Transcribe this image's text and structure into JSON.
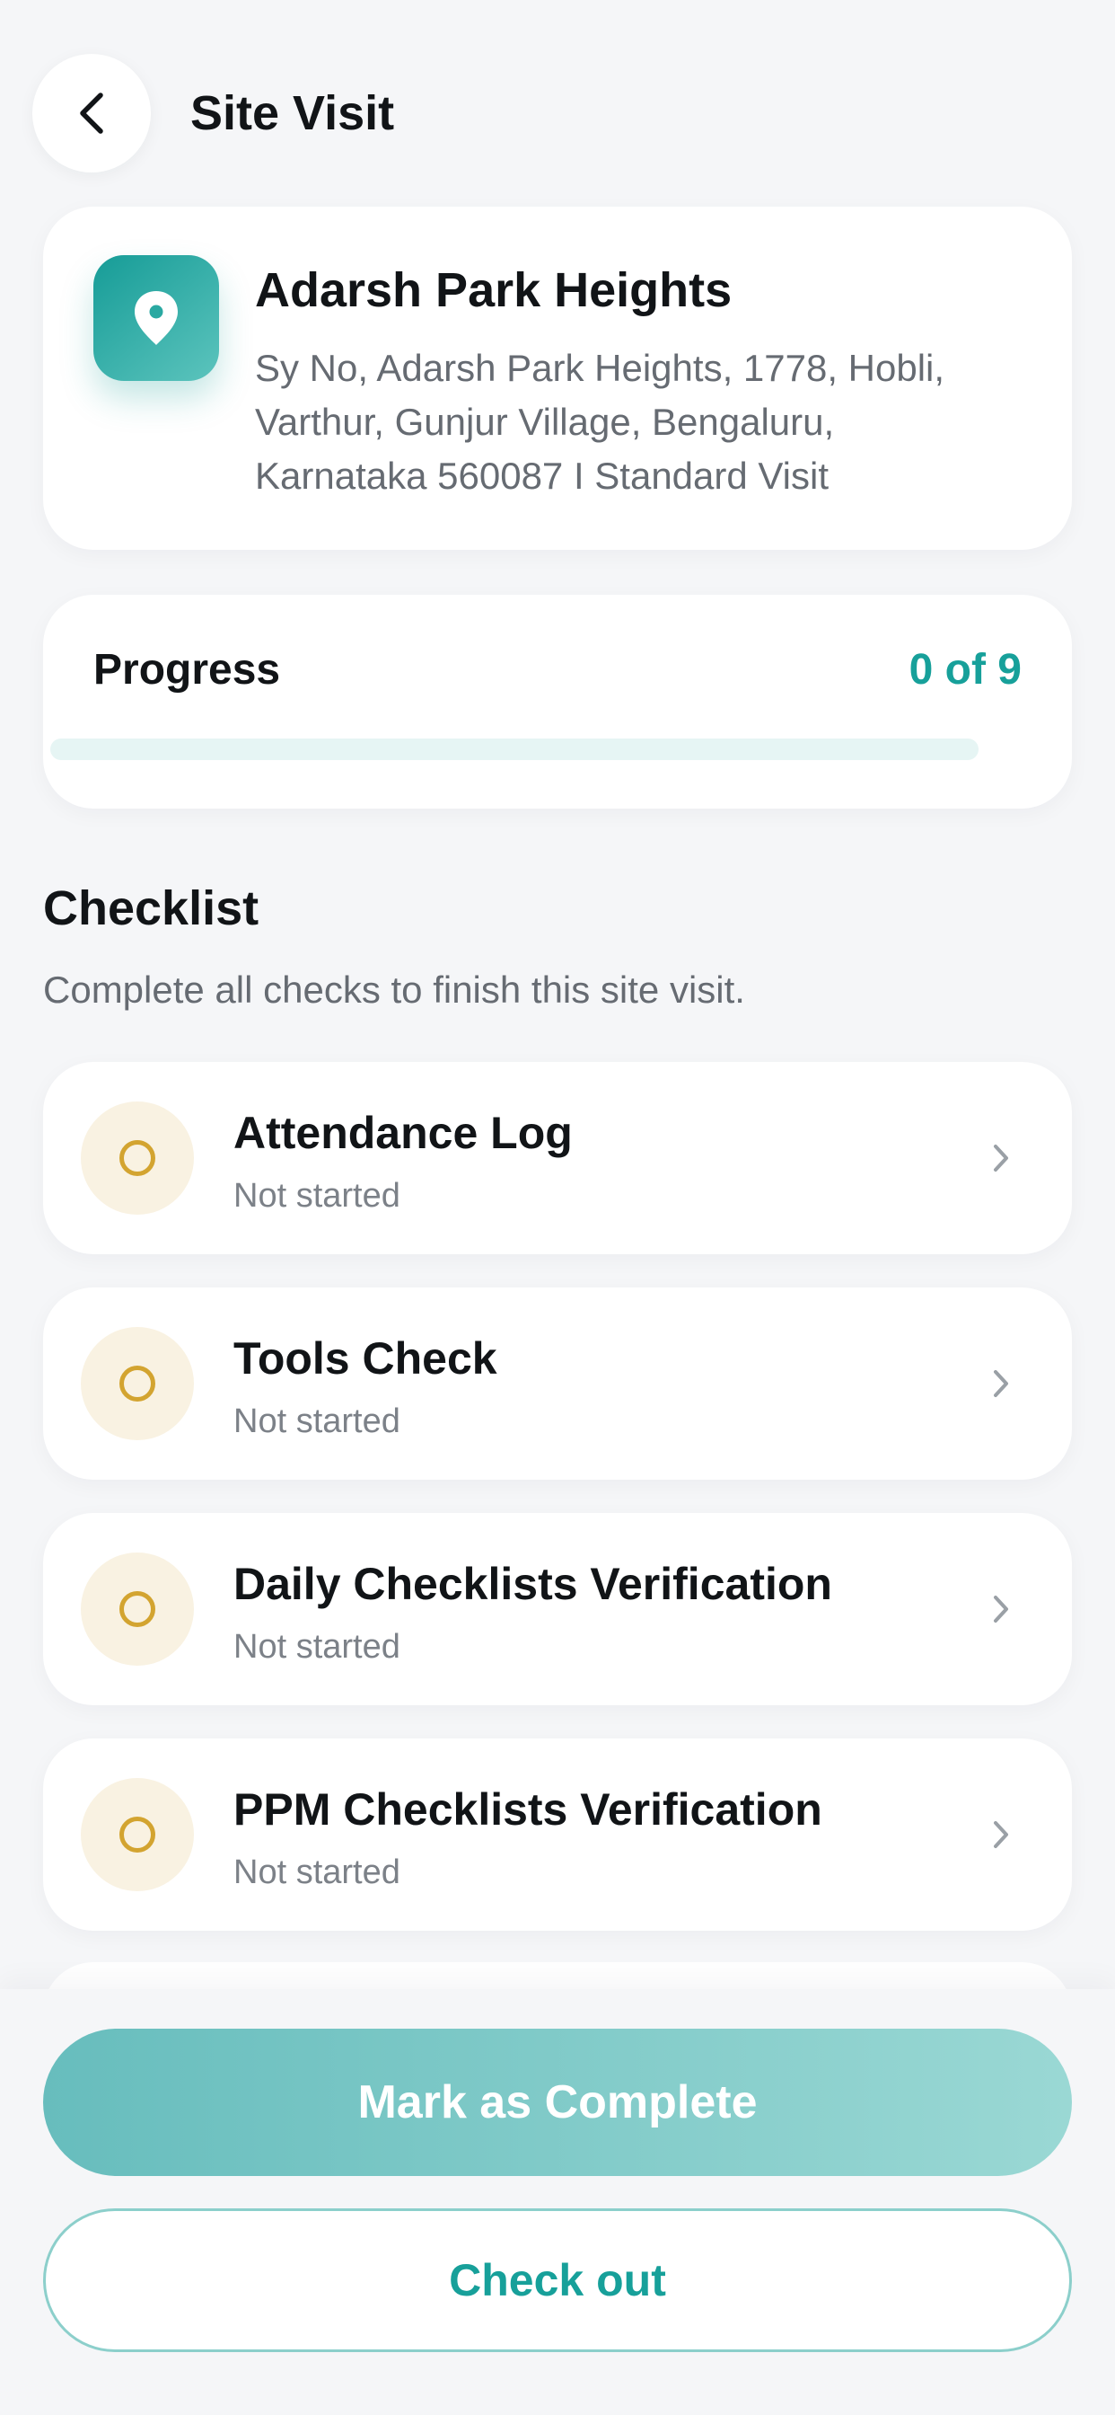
{
  "header": {
    "title": "Site Visit",
    "back_icon": "chevron-left-icon"
  },
  "site": {
    "name": "Adarsh Park Heights",
    "address": "Sy No, Adarsh Park Heights, 1778, Hobli, Varthur, Gunjur Village, Bengaluru, Karnataka 560087 I Standard Visit",
    "icon": "location-pin-icon",
    "icon_color_start": "#169c97",
    "icon_color_end": "#5cc4bd"
  },
  "progress": {
    "label": "Progress",
    "count_text": "0 of 9",
    "completed": 0,
    "total": 9,
    "accent_color": "#17a09a"
  },
  "checklist": {
    "title": "Checklist",
    "subtitle": "Complete all checks to finish this site visit.",
    "items": [
      {
        "title": "Attendance Log",
        "status": "Not started"
      },
      {
        "title": "Tools Check",
        "status": "Not started"
      },
      {
        "title": "Daily Checklists Verification",
        "status": "Not started"
      },
      {
        "title": "PPM Checklists Verification",
        "status": "Not started"
      }
    ],
    "status_color": "#d3a430"
  },
  "actions": {
    "primary_label": "Mark as Complete",
    "secondary_label": "Check out"
  }
}
